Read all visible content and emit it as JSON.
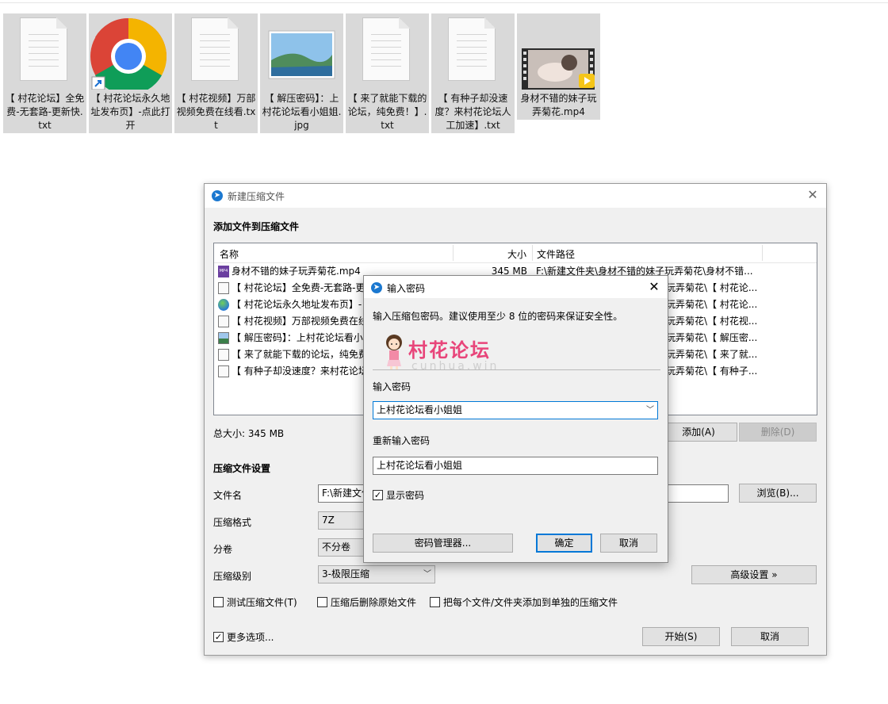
{
  "desktop": {
    "files": [
      {
        "name": "【 村花论坛】全免费-无套路-更新快.txt",
        "icon": "text-file-icon"
      },
      {
        "name": "【 村花论坛永久地址发布页】-点此打开",
        "icon": "chrome-shortcut-icon"
      },
      {
        "name": "【 村花视频】万部视频免费在线看.txt",
        "icon": "text-file-icon"
      },
      {
        "name": "【 解压密码】：上村花论坛看小姐姐.jpg",
        "icon": "image-file-icon"
      },
      {
        "name": "【 来了就能下载的论坛，纯免费！】.txt",
        "icon": "text-file-icon"
      },
      {
        "name": "【 有种子却没速度？来村花论坛人工加速】.txt",
        "icon": "text-file-icon"
      },
      {
        "name": "身材不错的妹子玩弄菊花.mp4",
        "icon": "video-file-icon"
      }
    ]
  },
  "main_window": {
    "title": "新建压缩文件",
    "section_add": "添加文件到压缩文件",
    "columns": {
      "name": "名称",
      "size": "大小",
      "path": "文件路径"
    },
    "files": [
      {
        "name": "身材不错的妹子玩弄菊花.mp4",
        "size": "345 MB",
        "path": "F:\\新建文件夹\\身材不错的妹子玩弄菊花\\身材不错...",
        "icon": "mp4"
      },
      {
        "name": "【 村花论坛】全免费-无套路-更",
        "size": "",
        "path": "玩弄菊花\\【 村花论...",
        "icon": "txt"
      },
      {
        "name": "【 村花论坛永久地址发布页】-",
        "size": "",
        "path": "玩弄菊花\\【 村花论...",
        "icon": "globe"
      },
      {
        "name": "【 村花视频】万部视频免费在线",
        "size": "",
        "path": "玩弄菊花\\【 村花视...",
        "icon": "txt"
      },
      {
        "name": "【 解压密码】：上村花论坛看小",
        "size": "",
        "path": "玩弄菊花\\【 解压密...",
        "icon": "img"
      },
      {
        "name": "【 来了就能下载的论坛，纯免费",
        "size": "",
        "path": "玩弄菊花\\【 来了就...",
        "icon": "txt"
      },
      {
        "name": "【 有种子却没速度？来村花论坛",
        "size": "",
        "path": "玩弄菊花\\【 有种子...",
        "icon": "txt"
      }
    ],
    "total_size": "总大小: 345 MB",
    "add_button": "添加(A)",
    "delete_button": "删除(D)",
    "section_settings": "压缩文件设置",
    "filename_label": "文件名",
    "filename_value": "F:\\新建文件",
    "browse_button": "浏览(B)...",
    "format_label": "压缩格式",
    "format_value": "7Z",
    "volume_label": "分卷",
    "volume_value": "不分卷",
    "level_label": "压缩级别",
    "level_value": "3-极限压缩",
    "advanced_button": "高级设置 »",
    "options": {
      "test": {
        "label": "测试压缩文件(T)",
        "checked": false
      },
      "delete_after": {
        "label": "压缩后删除原始文件",
        "checked": false
      },
      "separate": {
        "label": "把每个文件/文件夹添加到单独的压缩文件",
        "checked": false
      }
    },
    "more_options": {
      "label": "更多选项...",
      "checked": true
    },
    "start_button": "开始(S)",
    "cancel_button": "取消"
  },
  "password_dialog": {
    "title": "输入密码",
    "hint": "输入压缩包密码。建议使用至少 8 位的密码来保证安全性。",
    "watermark_text": "村花论坛",
    "watermark_sub": "cunhua.win",
    "enter_label": "输入密码",
    "enter_value": "上村花论坛看小姐姐",
    "reenter_label": "重新输入密码",
    "reenter_value": "上村花论坛看小姐姐",
    "show_password": {
      "label": "显示密码",
      "checked": true
    },
    "manager_button": "密码管理器...",
    "ok_button": "确定",
    "cancel_button": "取消"
  },
  "colors": {
    "accent": "#0078d7",
    "watermark": "#e8457a"
  }
}
